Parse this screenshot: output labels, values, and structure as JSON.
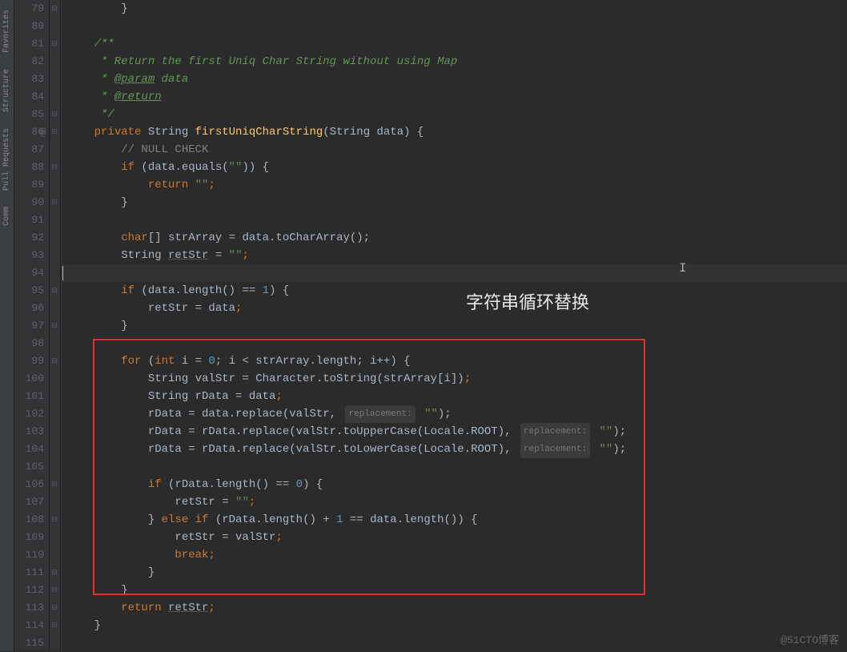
{
  "sidebar": {
    "tabs": [
      "Favorites",
      "Structure",
      "Pull Requests",
      "Comm"
    ]
  },
  "gutter": {
    "start": 79,
    "end": 115,
    "at_marker": "@",
    "at_line": 86
  },
  "annotation": "字符串循环替换",
  "watermark": "@51CTO博客",
  "hints": {
    "replacement": "replacement:"
  },
  "code": {
    "l79": "        }",
    "l80": "",
    "l81_a": "    /**",
    "l82_a": "     * Return the first Uniq Char String without using Map",
    "l83_a": "     * ",
    "l83_b": "@param",
    "l83_c": " data",
    "l84_a": "     * ",
    "l84_b": "@return",
    "l85_a": "     */",
    "l86_kw1": "private",
    "l86_t1": " String ",
    "l86_fn": "firstUniqCharString",
    "l86_p1": "(",
    "l86_t2": "String data",
    "l86_p2": ") {",
    "l87_a": "        ",
    "l87_c": "// NULL CHECK",
    "l88_a": "        ",
    "l88_kw": "if",
    "l88_b": " (data.equals(",
    "l88_s": "\"\"",
    "l88_c": ")) {",
    "l89_a": "            ",
    "l89_kw": "return",
    "l89_b": " ",
    "l89_s": "\"\"",
    "l89_c": ";",
    "l90": "        }",
    "l91": "",
    "l92_a": "        ",
    "l92_kw": "char",
    "l92_b": "[] strArray = data.toCharArray();",
    "l93_a": "        String ",
    "l93_u": "retStr",
    "l93_b": " = ",
    "l93_s": "\"\"",
    "l93_c": ";",
    "l94": "",
    "l95_a": "        ",
    "l95_kw": "if",
    "l95_b": " (data.length() == ",
    "l95_n": "1",
    "l95_c": ") {",
    "l96_a": "            retStr = data",
    "l96_b": ";",
    "l97": "        }",
    "l98": "",
    "l99_a": "        ",
    "l99_kw1": "for",
    "l99_b": " (",
    "l99_kw2": "int",
    "l99_c": " i = ",
    "l99_n1": "0",
    "l99_d": "; i < strArray.length; i++) {",
    "l100_a": "            String valStr = Character.toString(strArray[i])",
    "l100_b": ";",
    "l101_a": "            String rData = data",
    "l101_b": ";",
    "l102_a": "            rData = data.replace(valStr, ",
    "l102_s": "\"\"",
    "l102_b": ");",
    "l103_a": "            rData = rData.replace(valStr.toUpperCase(Locale.ROOT), ",
    "l103_s": "\"\"",
    "l103_b": ");",
    "l104_a": "            rData = rData.replace(valStr.toLowerCase(Locale.ROOT), ",
    "l104_s": "\"\"",
    "l104_b": ");",
    "l105": "",
    "l106_a": "            ",
    "l106_kw": "if",
    "l106_b": " (rData.length() == ",
    "l106_n": "0",
    "l106_c": ") {",
    "l107_a": "                retStr = ",
    "l107_s": "\"\"",
    "l107_b": ";",
    "l108_a": "            } ",
    "l108_kw1": "else",
    "l108_b": " ",
    "l108_kw2": "if",
    "l108_c": " (rData.length() + ",
    "l108_n": "1",
    "l108_d": " == data.length()) {",
    "l109_a": "                retStr = valStr",
    "l109_b": ";",
    "l110_a": "                ",
    "l110_kw": "break",
    "l110_b": ";",
    "l111": "            }",
    "l112": "        }",
    "l113_a": "        ",
    "l113_kw": "return",
    "l113_b": " ",
    "l113_u": "retStr",
    "l113_c": ";",
    "l114": "    }",
    "l115": ""
  }
}
